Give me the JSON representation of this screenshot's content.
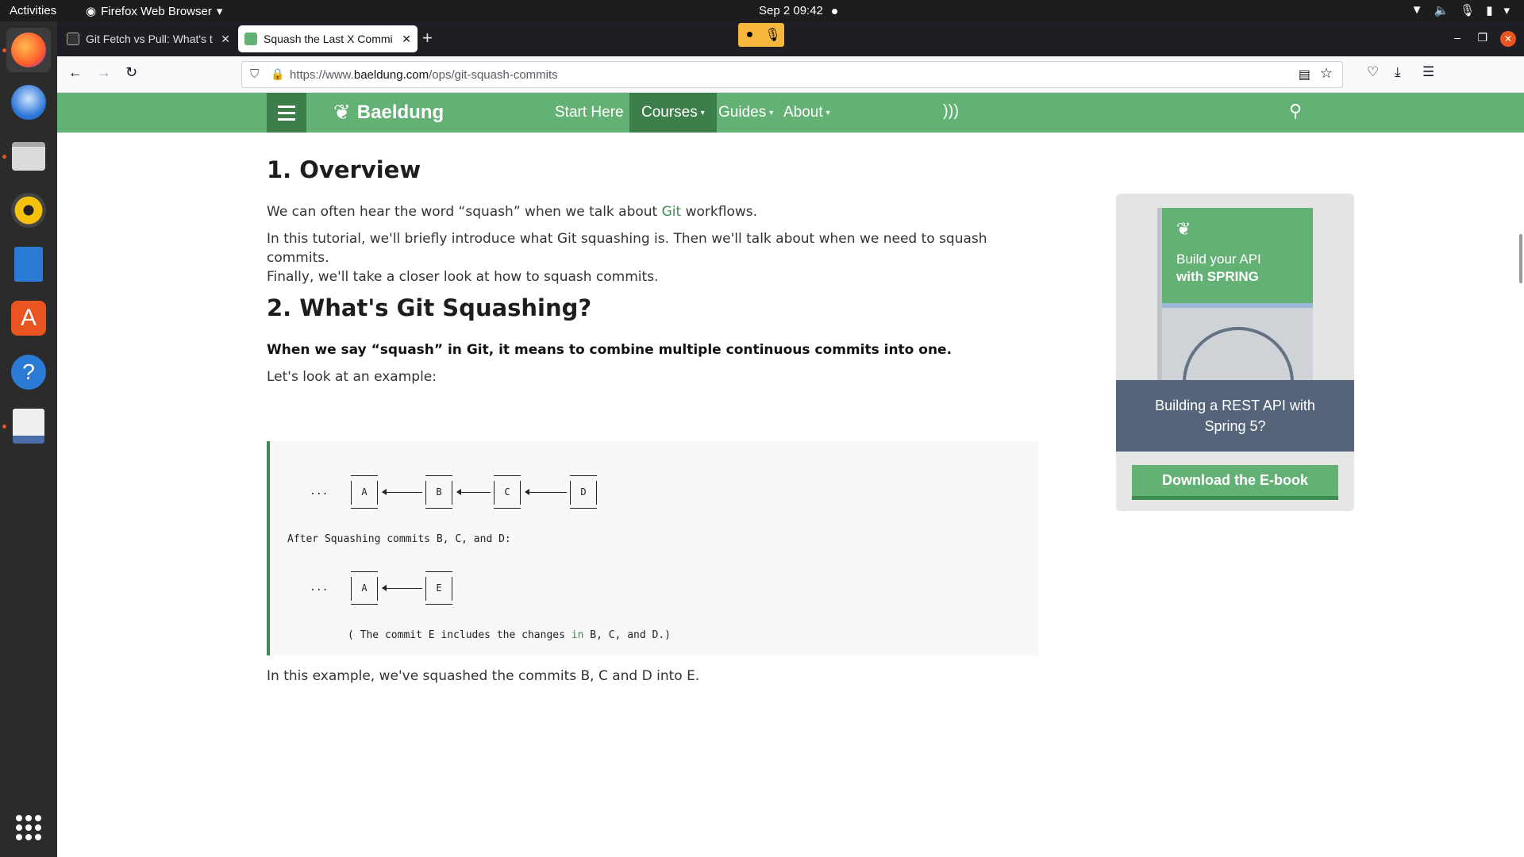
{
  "system": {
    "activities": "Activities",
    "app_menu": "Firefox Web Browser",
    "clock": "Sep 2  09:42"
  },
  "browser": {
    "tabs": [
      {
        "title": "Git Fetch vs Pull: What's t"
      },
      {
        "title": "Squash the Last X Commi"
      }
    ],
    "url_prefix": "https://www.",
    "url_domain": "baeldung.com",
    "url_path": "/ops/git-squash-commits"
  },
  "site": {
    "logo": "Baeldung",
    "menu": [
      "Start Here",
      "Courses",
      "Guides",
      "About"
    ]
  },
  "article": {
    "h1": "1. Overview",
    "p1_before": "We can often hear the word “squash” when we talk about ",
    "p1_link": "Git",
    "p1_after": " workflows.",
    "p2_line1": "In this tutorial, we'll briefly introduce what Git squashing is. Then we'll talk about when we need to squash commits.",
    "p2_line2": "Finally, we'll take a closer look at how to squash commits.",
    "h2": "2. What's Git Squashing?",
    "p3": "When we say “squash” in Git, it means to combine multiple continuous commits into one.",
    "p4": "Let's look at an example:",
    "code": {
      "dots1": "...",
      "boxes1": [
        "A",
        "B",
        "C",
        "D"
      ],
      "after": "After Squashing commits B, C, and D:",
      "dots2": "...",
      "boxes2": [
        "A",
        "E"
      ],
      "note_before": "( The commit E includes the changes ",
      "note_kw": "in",
      "note_after": " B, C, and D.)"
    },
    "p5": "In this example, we've squashed the commits B, C and D into E."
  },
  "ebook": {
    "book_line1": "Build your API",
    "book_line2": "with SPRING",
    "caption": "Building a REST API with Spring 5?",
    "button": "Download the E-book"
  },
  "colors": {
    "brand_green": "#63b175",
    "dark_green": "#3d7f4b",
    "link_green": "#3d8d50",
    "caption_slate": "#56647a"
  }
}
